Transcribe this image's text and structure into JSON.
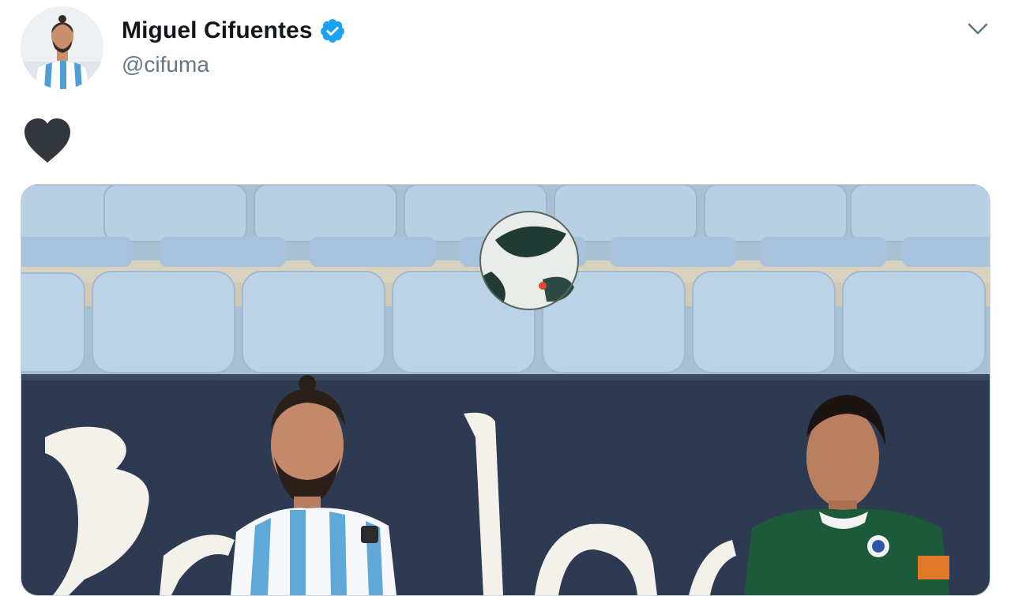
{
  "tweet": {
    "author": {
      "display_name": "Miguel Cifuentes",
      "handle": "@cifuma",
      "verified": true,
      "avatar_icon": "profile-photo-avatar"
    },
    "text_emoji": "black-heart",
    "menu_icon": "chevron-down-icon",
    "media": {
      "type": "photo",
      "description_icon": "football-match-photo"
    }
  },
  "colors": {
    "name_text": "#14171a",
    "handle_text": "#657786",
    "verified_badge": "#1da1f2",
    "heart": "#31373d",
    "seat_blue": "#b4cde2",
    "banner_navy": "#2e3a52",
    "malaga_stripe": "#5fa8d8",
    "deportivo_green": "#1d5a3a"
  }
}
